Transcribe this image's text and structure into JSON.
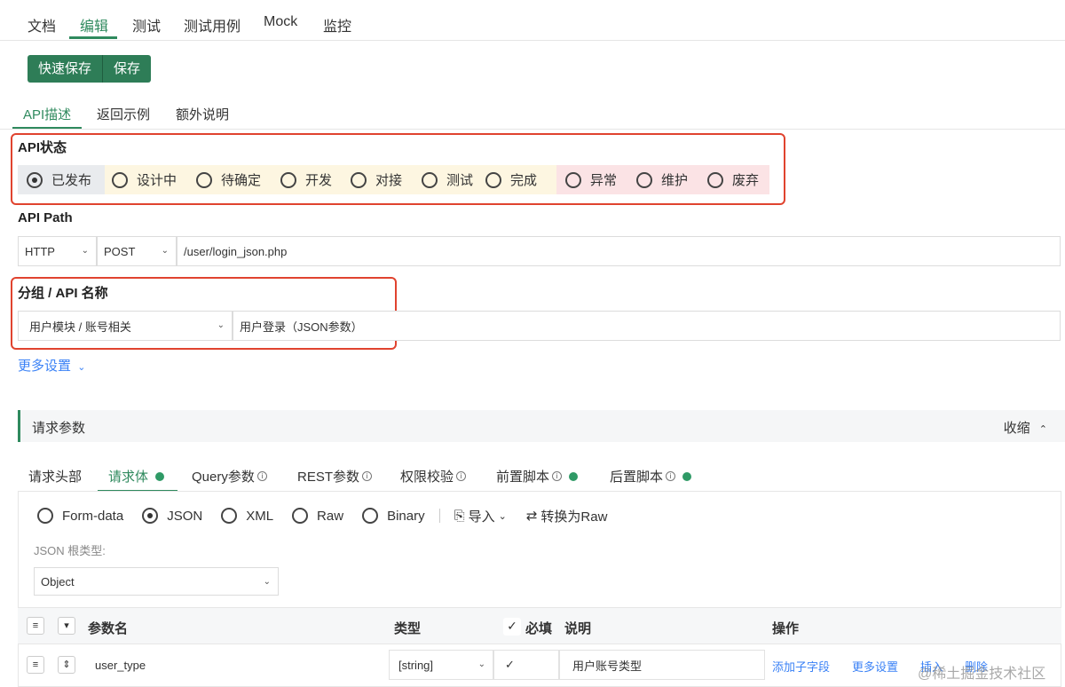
{
  "top_tabs": [
    "文档",
    "编辑",
    "测试",
    "测试用例",
    "Mock",
    "监控"
  ],
  "buttons": {
    "quick_save": "快速保存",
    "save": "保存"
  },
  "sub_tabs": [
    "API描述",
    "返回示例",
    "额外说明"
  ],
  "api_status": {
    "title": "API状态",
    "options": [
      "已发布",
      "设计中",
      "待确定",
      "开发",
      "对接",
      "测试",
      "完成",
      "异常",
      "维护",
      "废弃"
    ],
    "selected": "已发布"
  },
  "api_path": {
    "title": "API Path",
    "protocol": "HTTP",
    "method": "POST",
    "path": "/user/login_json.php"
  },
  "group": {
    "title": "分组 / API 名称",
    "group_value": "用户模块 / 账号相关",
    "api_name": "用户登录（JSON参数）"
  },
  "more_settings": "更多设置",
  "request_panel": {
    "title": "请求参数",
    "collapse": "收缩"
  },
  "request_tabs": [
    "请求头部",
    "请求体",
    "Query参数",
    "REST参数",
    "权限校验",
    "前置脚本",
    "后置脚本"
  ],
  "body_types": [
    "Form-data",
    "JSON",
    "XML",
    "Raw",
    "Binary"
  ],
  "body_selected": "JSON",
  "import_label": "导入",
  "convert_label": "转换为Raw",
  "json_root": {
    "label": "JSON 根类型:",
    "value": "Object"
  },
  "table": {
    "headers": {
      "name": "参数名",
      "type": "类型",
      "required": "必填",
      "desc": "说明",
      "ops": "操作"
    },
    "rows": [
      {
        "name": "user_type",
        "type": "[string]",
        "required": true,
        "desc": "用户账号类型",
        "ops": [
          "添加子字段",
          "更多设置",
          "插入",
          "删除"
        ]
      }
    ]
  },
  "watermark": "@稀土掘金技术社区",
  "colors": {
    "accent": "#2f8a5e",
    "highlight": "#e0432f",
    "link": "#3b82f6"
  }
}
